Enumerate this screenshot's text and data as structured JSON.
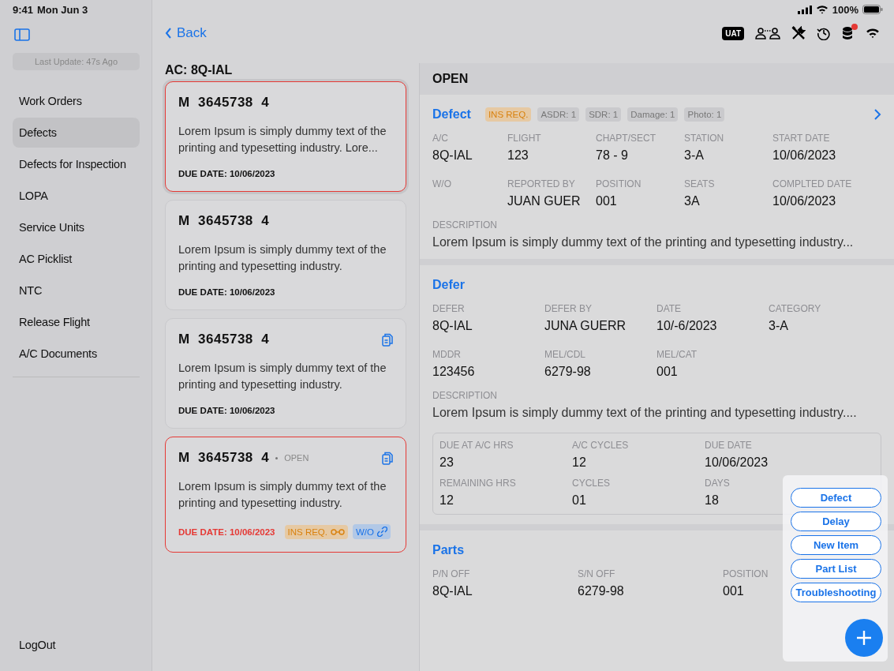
{
  "status_bar": {
    "time": "9:41",
    "date": "Mon Jun 3",
    "battery": "100%"
  },
  "sidebar": {
    "last_update": "Last Update: 47s Ago",
    "items": [
      {
        "label": "Work Orders",
        "selected": false
      },
      {
        "label": "Defects",
        "selected": true
      },
      {
        "label": "Defects for Inspection",
        "selected": false
      },
      {
        "label": "LOPA",
        "selected": false
      },
      {
        "label": "Service Units",
        "selected": false
      },
      {
        "label": "AC Picklist",
        "selected": false
      },
      {
        "label": "NTC",
        "selected": false
      },
      {
        "label": "Release Flight",
        "selected": false
      },
      {
        "label": "A/C Documents",
        "selected": false
      }
    ],
    "logout": "LogOut"
  },
  "nav": {
    "back": "Back",
    "env_badge": "UAT",
    "database_alert": true
  },
  "list": {
    "title": "AC: 8Q-IAL",
    "cards": [
      {
        "title": "M  3645738  4",
        "description": "Lorem Ipsum is simply dummy text of the printing and typesetting industry. Lore...",
        "due": "DUE DATE: 10/06/2023",
        "selected": true,
        "overdue": false,
        "attachment": false
      },
      {
        "title": "M  3645738  4",
        "description": "Lorem Ipsum is simply dummy text of the printing and typesetting industry.",
        "due": "DUE DATE: 10/06/2023",
        "selected": false,
        "overdue": false,
        "attachment": false
      },
      {
        "title": "M  3645738  4",
        "description": "Lorem Ipsum is simply dummy text of the printing and typesetting industry.",
        "due": "DUE DATE: 10/06/2023",
        "selected": false,
        "overdue": false,
        "attachment": true
      },
      {
        "title": "M  3645738  4",
        "status": "OPEN",
        "description": "Lorem Ipsum is simply dummy text of the printing and typesetting industry.",
        "due": "DUE DATE: 10/06/2023",
        "selected": false,
        "overdue": true,
        "attachment": true,
        "tags": [
          {
            "label": "INS REQ.",
            "kind": "warning"
          },
          {
            "label": "W/O",
            "kind": "info"
          }
        ]
      }
    ]
  },
  "detail": {
    "status": "OPEN",
    "defect": {
      "title": "Defect",
      "tags": [
        {
          "label": "INS REQ.",
          "kind": "warning"
        },
        {
          "label": "ASDR: 1",
          "kind": "neutral"
        },
        {
          "label": "SDR: 1",
          "kind": "neutral"
        },
        {
          "label": "Damage: 1",
          "kind": "neutral"
        },
        {
          "label": "Photo: 1",
          "kind": "neutral"
        }
      ],
      "fields": [
        {
          "label": "A/C",
          "value": "8Q-IAL"
        },
        {
          "label": "FLIGHT",
          "value": "123"
        },
        {
          "label": "CHAPT/SECT",
          "value": "78 - 9"
        },
        {
          "label": "STATION",
          "value": "3-A"
        },
        {
          "label": "START DATE",
          "value": "10/06/2023"
        },
        {
          "label": "W/O"
        },
        {
          "label": "REPORTED BY",
          "value": "JUAN GUER"
        },
        {
          "label": "POSITION",
          "value": "001"
        },
        {
          "label": "SEATS",
          "value": "3A"
        },
        {
          "label": "COMPLTED DATE",
          "value": "10/06/2023"
        }
      ],
      "description_label": "DESCRIPTION",
      "description": "Lorem Ipsum is simply dummy text of the printing and typesetting industry..."
    },
    "defer": {
      "title": "Defer",
      "fields": [
        {
          "label": "DEFER",
          "value": "8Q-IAL"
        },
        {
          "label": "DEFER BY",
          "value": "JUNA GUERR"
        },
        {
          "label": "DATE",
          "value": "10/-6/2023"
        },
        {
          "label": "CATEGORY",
          "value": "3-A"
        },
        {
          "label": "MDDR",
          "value": "123456"
        },
        {
          "label": "MEL/CDL",
          "value": "6279-98"
        },
        {
          "label": "MEL/CAT",
          "value": "001"
        }
      ],
      "description_label": "DESCRIPTION",
      "description": "Lorem Ipsum is simply dummy text of the printing and typesetting industry....",
      "limits": [
        {
          "label": "DUE AT A/C HRS",
          "value": "23"
        },
        {
          "label": "A/C CYCLES",
          "value": "12"
        },
        {
          "label": "DUE DATE",
          "value": "10/06/2023"
        },
        {
          "label": "REMAINING HRS",
          "value": "12"
        },
        {
          "label": "CYCLES",
          "value": "01"
        },
        {
          "label": "DAYS",
          "value": "18"
        }
      ]
    },
    "parts": {
      "title": "Parts",
      "fields": [
        {
          "label": "P/N OFF",
          "value": "8Q-IAL"
        },
        {
          "label": "S/N OFF",
          "value": "6279-98"
        },
        {
          "label": "POSITION",
          "value": "001"
        }
      ]
    }
  },
  "add_menu": {
    "expanded": true,
    "items": [
      "Defect",
      "Delay",
      "New Item",
      "Part List",
      "Troubleshooting"
    ]
  }
}
